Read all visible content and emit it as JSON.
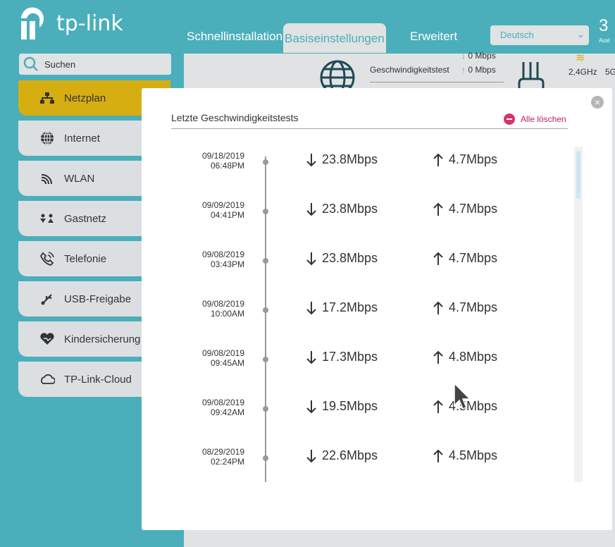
{
  "brand": {
    "logo_text": "tp-link"
  },
  "nav": {
    "tabs": [
      {
        "label": "Schnellinstallation"
      },
      {
        "label": "Basiseinstellungen",
        "active": true
      },
      {
        "label": "Erweitert"
      }
    ],
    "language": "Deutsch",
    "logout_icon_text": "3",
    "logout_label": "Ausl"
  },
  "search": {
    "placeholder": "Suchen"
  },
  "sidebar": {
    "items": [
      {
        "label": "Netzplan",
        "icon": "network-map-icon",
        "active": true
      },
      {
        "label": "Internet",
        "icon": "globe-icon"
      },
      {
        "label": "WLAN",
        "icon": "wifi-icon"
      },
      {
        "label": "Gastnetz",
        "icon": "guests-icon"
      },
      {
        "label": "Telefonie",
        "icon": "phone-icon"
      },
      {
        "label": "USB-Freigabe",
        "icon": "usb-icon"
      },
      {
        "label": "Kindersicherung",
        "icon": "heart-icon"
      },
      {
        "label": "TP-Link-Cloud",
        "icon": "cloud-icon"
      }
    ]
  },
  "background": {
    "speedtest_label": "Geschwindigkeitstest",
    "down": "0",
    "up": "0",
    "unit": "Mbps",
    "band_24": "2,4GHz",
    "band_5": "5G"
  },
  "modal": {
    "title": "Letzte Geschwindigkeitstests",
    "clear_all": "Alle löschen",
    "tests": [
      {
        "date": "09/18/2019",
        "time": "06:48PM",
        "down": "23.8Mbps",
        "up": "4.7Mbps"
      },
      {
        "date": "09/09/2019",
        "time": "04:41PM",
        "down": "23.8Mbps",
        "up": "4.7Mbps"
      },
      {
        "date": "09/08/2019",
        "time": "03:43PM",
        "down": "23.8Mbps",
        "up": "4.7Mbps"
      },
      {
        "date": "09/08/2019",
        "time": "10:00AM",
        "down": "17.2Mbps",
        "up": "4.7Mbps"
      },
      {
        "date": "09/08/2019",
        "time": "09:45AM",
        "down": "17.3Mbps",
        "up": "4.8Mbps"
      },
      {
        "date": "09/08/2019",
        "time": "09:42AM",
        "down": "19.5Mbps",
        "up": "4.5Mbps"
      },
      {
        "date": "08/29/2019",
        "time": "02:24PM",
        "down": "22.6Mbps",
        "up": "4.5Mbps"
      }
    ]
  },
  "colors": {
    "header": "#4aafba",
    "active_item": "#d6ae12",
    "clear_accent": "#d4336e"
  }
}
